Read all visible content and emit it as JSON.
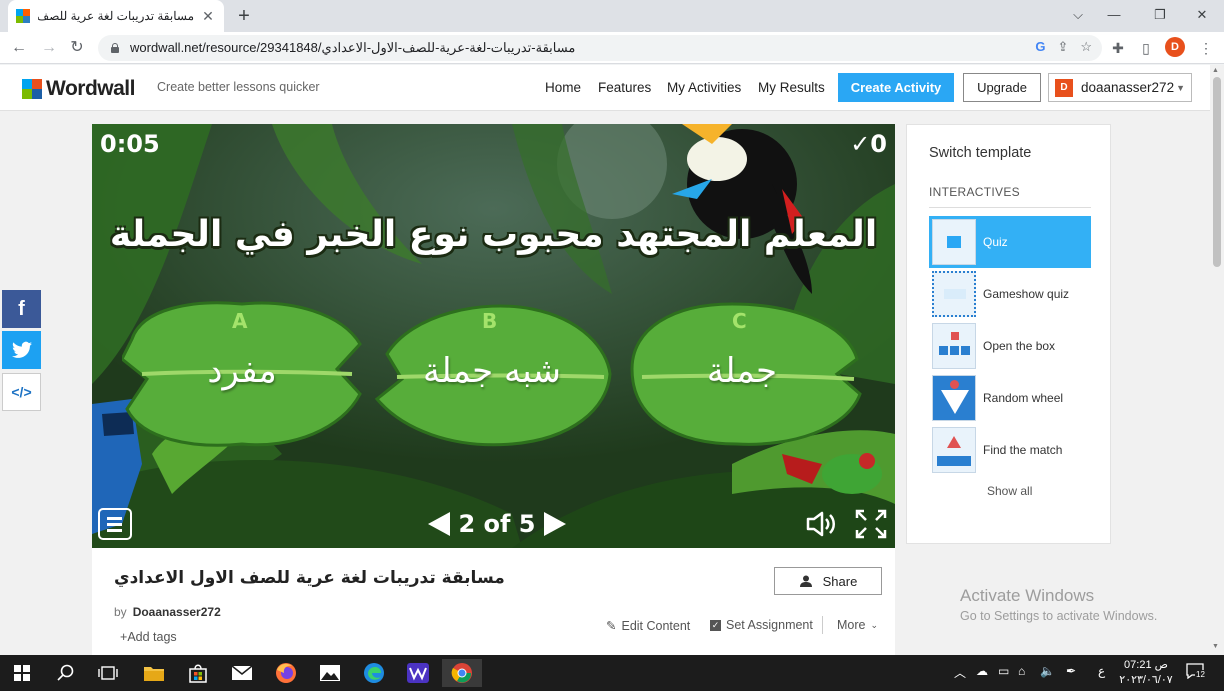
{
  "browser": {
    "tab_title": "مسابقة تدريبات لغة عرية للصف الا",
    "url": "wordwall.net/resource/29341848/مسابقة-تدريبات-لغة-عرية-للصف-الاول-الاعدادي",
    "profile_letter": "D"
  },
  "header": {
    "logo": "Wordwall",
    "tagline": "Create better lessons quicker",
    "nav": [
      "Home",
      "Features",
      "My Activities",
      "My Results"
    ],
    "create_label": "Create Activity",
    "upgrade_label": "Upgrade",
    "user_initial": "D",
    "username": "doaanasser272"
  },
  "game": {
    "timer": "0:05",
    "score": "0",
    "question": "المعلم المجتهد محبوب نوع الخبر في الجملة",
    "answers": [
      {
        "letter": "A",
        "text": "مفرد"
      },
      {
        "letter": "B",
        "text": "شبه جملة"
      },
      {
        "letter": "C",
        "text": "جملة"
      }
    ],
    "page": "2 of 5"
  },
  "activity": {
    "title": "مسابقة تدريبات لغة عرية للصف الاول الاعدادي",
    "by_label": "by",
    "author": "Doaanasser272",
    "add_tags": "Add tags",
    "share_label": "Share",
    "edit_label": "Edit Content",
    "assign_label": "Set Assignment",
    "more_label": "More"
  },
  "templates": {
    "title": "Switch template",
    "section": "INTERACTIVES",
    "items": [
      "Quiz",
      "Gameshow quiz",
      "Open the box",
      "Random wheel",
      "Find the match"
    ],
    "show_all": "Show all"
  },
  "watermark": {
    "line1": "Activate Windows",
    "line2": "Go to Settings to activate Windows."
  },
  "taskbar": {
    "keyboard_lang": "ع",
    "time": "07:21 ص",
    "date": "٢٠٢٣/٠٦/٠٧",
    "notifications": "12"
  },
  "colors": {
    "accent": "#2aa7f4",
    "brand_orange": "#e8501c",
    "jungle": "#1f3a1c",
    "leaf": "#4f9a2f"
  }
}
